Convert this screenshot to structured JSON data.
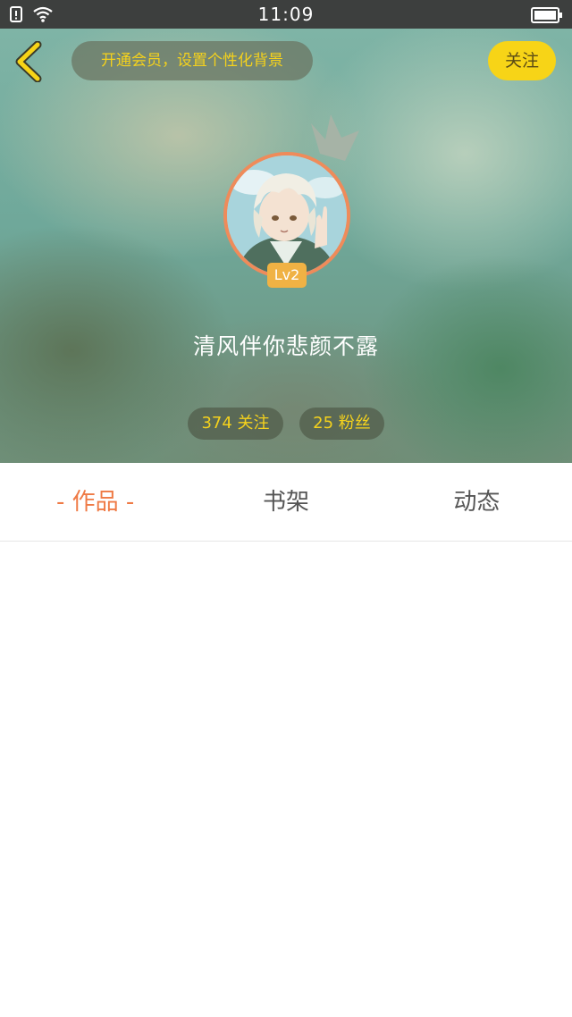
{
  "status_bar": {
    "time": "11:09"
  },
  "header": {
    "vip_prompt": "开通会员，设置个性化背景",
    "follow_label": "关注",
    "level": "Lv2",
    "username": "清风伴你悲颜不露",
    "following": "374 关注",
    "fans": "25 粉丝"
  },
  "tabs": [
    {
      "label": "- 作品 -"
    },
    {
      "label": "书架"
    },
    {
      "label": "动态"
    }
  ],
  "colors": {
    "accent_yellow": "#f7d417",
    "active_tab": "#ef7a45",
    "level_badge": "#f0b244"
  }
}
